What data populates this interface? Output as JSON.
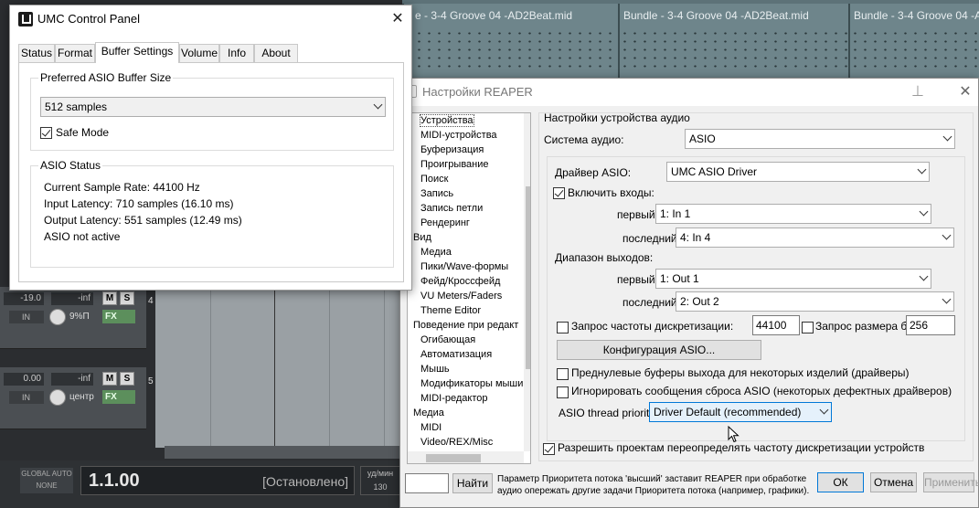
{
  "daw": {
    "clips": [
      {
        "title": "e - 3-4 Groove 04 -AD2Beat.mid"
      },
      {
        "title": "Bundle - 3-4 Groove 04 -AD2Beat.mid"
      },
      {
        "title": "Bundle - 3-4 Groove 04 -AD2E"
      }
    ],
    "tracks": [
      {
        "volume": "-19.0",
        "peak": "-inf",
        "in": "IN",
        "pan": "9%П",
        "fx": "FX",
        "num": "4",
        "mute": "M",
        "solo": "S"
      },
      {
        "volume": "0.00",
        "peak": "-inf",
        "in": "IN",
        "pan": "центр",
        "fx": "FX",
        "num": "5",
        "mute": "M",
        "solo": "S"
      }
    ],
    "transport": {
      "global_auto": "GLOBAL AUTO",
      "global_auto_value": "NONE",
      "position": "1.1.00",
      "state": "[Остановлено]",
      "bpm_label": "уд/мин",
      "bpm": "130"
    }
  },
  "umc": {
    "title": "UMC Control Panel",
    "tabs": [
      "Status",
      "Format",
      "Buffer Settings",
      "Volume",
      "Info",
      "About"
    ],
    "active_tab": "Buffer Settings",
    "buffer_group": "Preferred ASIO Buffer Size",
    "buffer_value": "512 samples",
    "safe_mode": "Safe Mode",
    "status_group": "ASIO Status",
    "status_lines": [
      "Current Sample Rate: 44100 Hz",
      "Input Latency: 710 samples (16.10 ms)",
      "Output Latency: 551 samples (12.49 ms)",
      "ASIO not active"
    ]
  },
  "prefs": {
    "title": "Настройки REAPER",
    "tree": [
      {
        "label": "Устройства",
        "indent": 1,
        "selected": true
      },
      {
        "label": "MIDI-устройства",
        "indent": 1
      },
      {
        "label": "Буферизация",
        "indent": 1
      },
      {
        "label": "Проигрывание",
        "indent": 1
      },
      {
        "label": "Поиск",
        "indent": 1
      },
      {
        "label": "Запись",
        "indent": 1
      },
      {
        "label": "Запись петли",
        "indent": 1
      },
      {
        "label": "Рендеринг",
        "indent": 1
      },
      {
        "label": "Вид",
        "indent": 0
      },
      {
        "label": "Медиа",
        "indent": 1
      },
      {
        "label": "Пики/Wave-формы",
        "indent": 1
      },
      {
        "label": "Фейд/Кроссфейд",
        "indent": 1
      },
      {
        "label": "VU Meters/Faders",
        "indent": 1
      },
      {
        "label": "Theme Editor",
        "indent": 1
      },
      {
        "label": "Поведение при редакт",
        "indent": 0
      },
      {
        "label": "Огибающая",
        "indent": 1
      },
      {
        "label": "Автоматизация",
        "indent": 1
      },
      {
        "label": "Мышь",
        "indent": 1
      },
      {
        "label": "Модификаторы мыши",
        "indent": 1
      },
      {
        "label": "MIDI-редактор",
        "indent": 1
      },
      {
        "label": "Медиа",
        "indent": 0
      },
      {
        "label": "MIDI",
        "indent": 1
      },
      {
        "label": "Video/REX/Misc",
        "indent": 1
      }
    ],
    "section_title": "Настройки устройства аудио",
    "audio_system_label": "Система аудио:",
    "audio_system_value": "ASIO",
    "driver_label": "Драйвер ASIO:",
    "driver_value": "UMC ASIO Driver",
    "enable_inputs": "Включить входы:",
    "first_label": "первый",
    "last_label": "последний",
    "input_first": "1: In 1",
    "input_last": "4: In 4",
    "outputs_label": "Диапазон выходов:",
    "output_first": "1: Out 1",
    "output_last": "2: Out 2",
    "sample_rate_label": "Запрос частоты дискретизации:",
    "sample_rate_value": "44100",
    "block_size_label": "Запрос размера бу",
    "block_size_value": "256",
    "asio_config": "Конфигурация ASIO...",
    "prezero_label": "Преднулевые буферы выхода для некоторых изделий (драйверы)",
    "ignore_reset_label": "Игнорировать сообщения сброса ASIO (некоторых дефектных драйверов)",
    "thread_priority_label": "ASIO thread priority:",
    "thread_priority_value": "Driver Default (recommended)",
    "allow_override_label": "Разрешить проектам переопределять частоту дискретизации устройств",
    "find_button": "Найти",
    "hint": "Параметр Приоритета потока 'высший' заставит REAPER при обработке аудио опережать другие задачи Приоритета потока (например, графики).",
    "ok": "ОК",
    "cancel": "Отмена",
    "apply": "Применить"
  }
}
